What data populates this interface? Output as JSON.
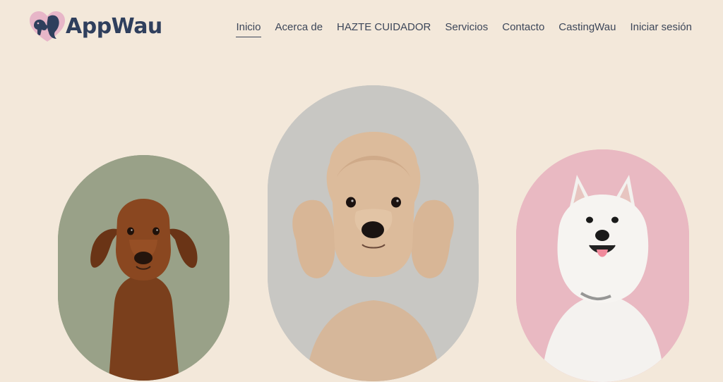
{
  "brand": {
    "name": "AppWau",
    "logo_icon": "dog-and-woman-heart-icon",
    "color": "#2f3f5d"
  },
  "nav": {
    "items": [
      {
        "label": "Inicio",
        "active": true
      },
      {
        "label": "Acerca de",
        "active": false
      },
      {
        "label": "HAZTE CUIDADOR",
        "active": false
      },
      {
        "label": "Servicios",
        "active": false
      },
      {
        "label": "Contacto",
        "active": false
      },
      {
        "label": "CastingWau",
        "active": false
      },
      {
        "label": "Iniciar sesión",
        "active": false
      }
    ]
  },
  "gallery": {
    "images": [
      {
        "subject": "dachshund",
        "background": "#9ba48a"
      },
      {
        "subject": "poodle",
        "background": "#c7c6c2"
      },
      {
        "subject": "samoyed",
        "background": "#e8b8c1"
      }
    ]
  },
  "colors": {
    "page_background": "#f3e8da",
    "nav_text": "#3c4659"
  }
}
